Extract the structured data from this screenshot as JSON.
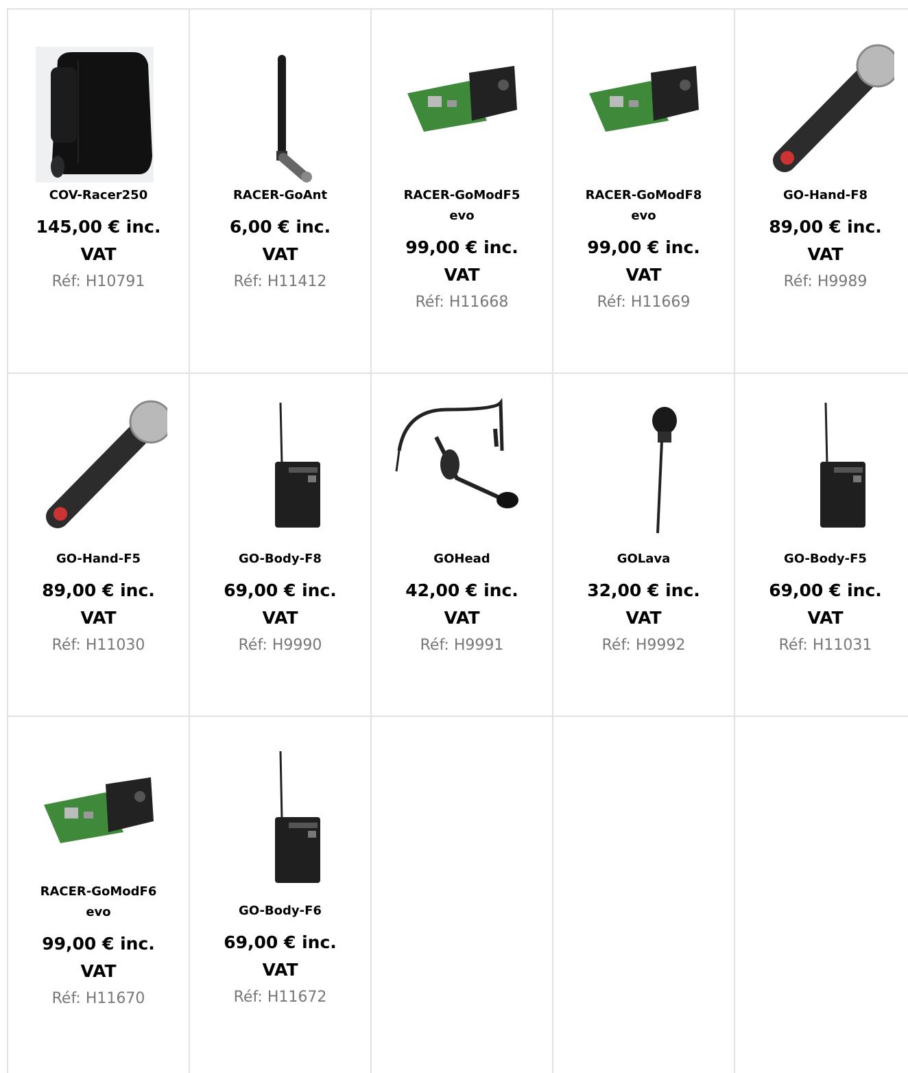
{
  "products": [
    {
      "name": "COV-Racer250",
      "price": "145,00 € inc. VAT",
      "ref": "Réf: H10791",
      "icon": "speaker-cover-icon"
    },
    {
      "name": "RACER-GoAnt",
      "price": "6,00 € inc. VAT",
      "ref": "Réf: H11412",
      "icon": "antenna-icon"
    },
    {
      "name": "RACER-GoModF5 evo",
      "price": "99,00 € inc. VAT",
      "ref": "Réf: H11668",
      "icon": "receiver-module-icon"
    },
    {
      "name": "RACER-GoModF8 evo",
      "price": "99,00 € inc. VAT",
      "ref": "Réf: H11669",
      "icon": "receiver-module-icon"
    },
    {
      "name": "GO-Hand-F8",
      "price": "89,00 € inc. VAT",
      "ref": "Réf: H9989",
      "icon": "handheld-microphone-icon"
    },
    {
      "name": "GO-Hand-F5",
      "price": "89,00 € inc. VAT",
      "ref": "Réf: H11030",
      "icon": "handheld-microphone-icon"
    },
    {
      "name": "GO-Body-F8",
      "price": "69,00 € inc. VAT",
      "ref": "Réf: H9990",
      "icon": "bodypack-transmitter-icon"
    },
    {
      "name": "GOHead",
      "price": "42,00 € inc. VAT",
      "ref": "Réf: H9991",
      "icon": "headset-microphone-icon"
    },
    {
      "name": "GOLava",
      "price": "32,00 € inc. VAT",
      "ref": "Réf: H9992",
      "icon": "lavalier-microphone-icon"
    },
    {
      "name": "GO-Body-F5",
      "price": "69,00 € inc. VAT",
      "ref": "Réf: H11031",
      "icon": "bodypack-transmitter-icon"
    },
    {
      "name": "RACER-GoModF6 evo",
      "price": "99,00 € inc. VAT",
      "ref": "Réf: H11670",
      "icon": "receiver-module-icon"
    },
    {
      "name": "GO-Body-F6",
      "price": "69,00 € inc. VAT",
      "ref": "Réf: H11672",
      "icon": "bodypack-transmitter-icon"
    }
  ]
}
